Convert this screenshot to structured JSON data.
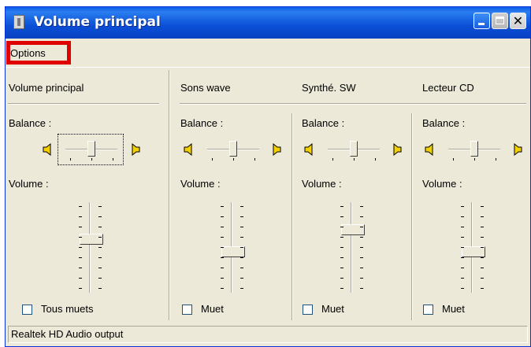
{
  "window": {
    "title": "Volume principal"
  },
  "menu": {
    "options": "Options"
  },
  "channels": [
    {
      "title": "Volume principal",
      "balance_label": "Balance :",
      "volume_label": "Volume :",
      "mute_label": "Tous muets",
      "muted": false,
      "balance": 0.5,
      "volume": 0.6
    },
    {
      "title": "Sons wave",
      "balance_label": "Balance :",
      "volume_label": "Volume :",
      "mute_label": "Muet",
      "muted": false,
      "balance": 0.5,
      "volume": 0.45
    },
    {
      "title": "Synthé. SW",
      "balance_label": "Balance :",
      "volume_label": "Volume :",
      "mute_label": "Muet",
      "muted": false,
      "balance": 0.5,
      "volume": 0.72
    },
    {
      "title": "Lecteur CD",
      "balance_label": "Balance :",
      "volume_label": "Volume :",
      "mute_label": "Muet",
      "muted": false,
      "balance": 0.5,
      "volume": 0.45
    }
  ],
  "status": {
    "text": "Realtek HD Audio output"
  }
}
